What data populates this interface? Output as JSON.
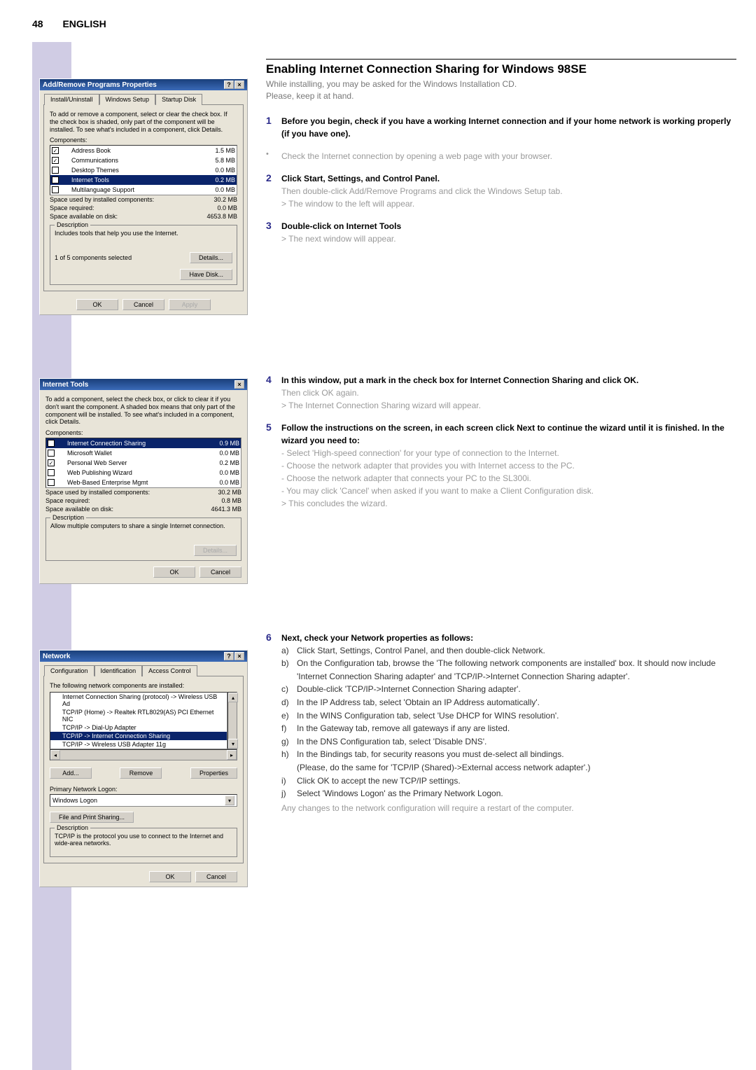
{
  "page": {
    "number": "48",
    "language": "ENGLISH"
  },
  "main": {
    "title": "Enabling Internet Connection Sharing for Windows 98SE",
    "intro1": "While installing, you may be asked for the Windows Installation CD.",
    "intro2": "Please, keep it at hand."
  },
  "steps": {
    "s1": {
      "num": "1",
      "bold": "Before you begin, check if you have a working Internet connection and if your home network is working properly (if you have one).",
      "bullet": "Check the Internet connection by opening a web page with your browser."
    },
    "s2": {
      "num": "2",
      "bold": "Click Start, Settings, and Control Panel.",
      "l1": "Then double-click Add/Remove Programs and click the Windows Setup tab.",
      "l2": "> The window to the left will appear."
    },
    "s3": {
      "num": "3",
      "bold": "Double-click on Internet Tools",
      "l1": "> The next window will appear."
    },
    "s4": {
      "num": "4",
      "bold": "In this window, put a mark in the check box for Internet Connection Sharing and click OK.",
      "l1": "Then click OK again.",
      "l2": "> The Internet Connection Sharing wizard will appear."
    },
    "s5": {
      "num": "5",
      "bold": "Follow the instructions on the screen, in each screen click Next to continue the wizard until it is finished. In the wizard you need to:",
      "l1": "- Select 'High-speed connection' for your type of connection to the Internet.",
      "l2": "- Choose the network adapter that provides you with Internet access to the PC.",
      "l3": "- Choose the network adapter that connects your PC to the SL300i.",
      "l4": "- You may click 'Cancel' when asked if you want to make a Client Configuration disk.",
      "l5": "> This concludes the wizard."
    },
    "s6": {
      "num": "6",
      "bold": "Next, check your Network properties as follows:",
      "a": "Click Start, Settings, Control Panel, and then double-click Network.",
      "b": "On the Configuration tab, browse the 'The following network components are installed' box. It should now include 'Internet Connection Sharing adapter' and 'TCP/IP->Internet Connection Sharing adapter'.",
      "c": "Double-click 'TCP/IP->Internet Connection Sharing adapter'.",
      "d": "In the IP Address tab, select 'Obtain an IP Address automatically'.",
      "e": "In the WINS Configuration tab, select 'Use DHCP for WINS resolution'.",
      "f": "In the Gateway tab, remove all gateways if any are listed.",
      "g": "In the DNS Configuration tab, select 'Disable DNS'.",
      "h": "In the Bindings tab, for security reasons you must de-select all bindings.",
      "h2": "(Please, do the same for 'TCP/IP (Shared)->External access network adapter'.)",
      "i": "Click OK to accept the new TCP/IP settings.",
      "j": "Select 'Windows Logon' as the Primary Network Logon.",
      "note": "Any changes to the network configuration will require a restart of the computer."
    }
  },
  "dlg1": {
    "title": "Add/Remove Programs Properties",
    "tabs": {
      "t1": "Install/Uninstall",
      "t2": "Windows Setup",
      "t3": "Startup Disk"
    },
    "instr": "To add or remove a component, select or clear the check box. If the check box is shaded, only part of the component will be installed. To see what's included in a component, click Details.",
    "comp_label": "Components:",
    "rows": [
      {
        "checked": true,
        "icon": "book",
        "name": "Address Book",
        "size": "1.5 MB"
      },
      {
        "checked": true,
        "icon": "comm",
        "name": "Communications",
        "size": "5.8 MB"
      },
      {
        "checked": false,
        "icon": "theme",
        "name": "Desktop Themes",
        "size": "0.0 MB"
      },
      {
        "checked": true,
        "icon": "net",
        "name": "Internet Tools",
        "size": "0.2 MB",
        "sel": true
      },
      {
        "checked": false,
        "icon": "globe",
        "name": "Multilanguage Support",
        "size": "0.0 MB"
      }
    ],
    "used_l": "Space used by installed components:",
    "used_v": "30.2 MB",
    "req_l": "Space required:",
    "req_v": "0.0 MB",
    "avail_l": "Space available on disk:",
    "avail_v": "4653.8 MB",
    "desc_l": "Description",
    "desc_v": "Includes tools that help you use the Internet.",
    "selcount": "1 of 5 components selected",
    "details": "Details...",
    "havedisk": "Have Disk...",
    "ok": "OK",
    "cancel": "Cancel",
    "apply": "Apply"
  },
  "dlg2": {
    "title": "Internet Tools",
    "instr": "To add a component, select the check box, or click to clear it if you don't want the component. A shaded box means that only part of the component will be installed. To see what's included in a component, click Details.",
    "comp_label": "Components:",
    "rows": [
      {
        "checked": true,
        "icon": "ics",
        "name": "Internet Connection Sharing",
        "size": "0.9 MB",
        "sel": true
      },
      {
        "checked": false,
        "icon": "wallet",
        "name": "Microsoft Wallet",
        "size": "0.0 MB"
      },
      {
        "checked": true,
        "icon": "pws",
        "name": "Personal Web Server",
        "size": "0.2 MB"
      },
      {
        "checked": false,
        "icon": "pub",
        "name": "Web Publishing Wizard",
        "size": "0.0 MB"
      },
      {
        "checked": false,
        "icon": "globe",
        "name": "Web-Based Enterprise Mgmt",
        "size": "0.0 MB"
      }
    ],
    "used_l": "Space used by installed components:",
    "used_v": "30.2 MB",
    "req_l": "Space required:",
    "req_v": "0.8 MB",
    "avail_l": "Space available on disk:",
    "avail_v": "4641.3 MB",
    "desc_l": "Description",
    "desc_v": "Allow multiple computers to share a single Internet connection.",
    "details": "Details...",
    "ok": "OK",
    "cancel": "Cancel"
  },
  "dlg3": {
    "title": "Network",
    "tabs": {
      "t1": "Configuration",
      "t2": "Identification",
      "t3": "Access Control"
    },
    "instr": "The following network components are installed:",
    "rows": [
      {
        "name": "Internet Connection Sharing (protocol) -> Wireless USB Ad"
      },
      {
        "name": "TCP/IP (Home) -> Realtek RTL8029(AS) PCI Ethernet NIC"
      },
      {
        "name": "TCP/IP -> Dial-Up Adapter"
      },
      {
        "name": "TCP/IP -> Internet Connection Sharing",
        "sel": true
      },
      {
        "name": "TCP/IP -> Wireless USB Adapter 11g"
      }
    ],
    "add": "Add...",
    "remove": "Remove",
    "props": "Properties",
    "primary_l": "Primary Network Logon:",
    "primary_v": "Windows Logon",
    "fps": "File and Print Sharing...",
    "desc_l": "Description",
    "desc_v": "TCP/IP is the protocol you use to connect to the Internet and wide-area networks.",
    "ok": "OK",
    "cancel": "Cancel"
  },
  "icons": {
    "help": "?",
    "close": "×",
    "check": "✓",
    "drop": "▾",
    "up": "▴",
    "down": "▾",
    "left": "◂",
    "right": "▸"
  }
}
